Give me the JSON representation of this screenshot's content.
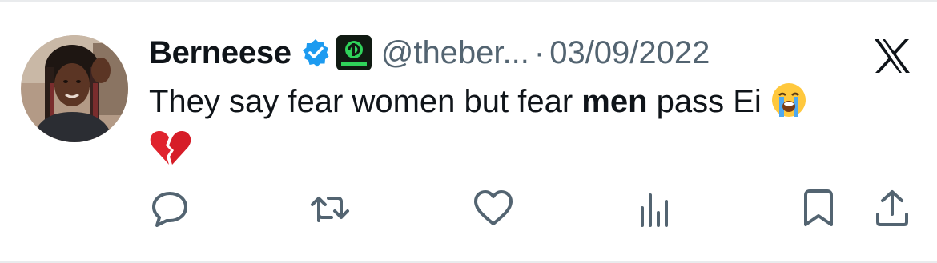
{
  "tweet": {
    "author_name": "Berneese",
    "handle": "@theber...",
    "separator": "·",
    "date": "03/09/2022",
    "text_before": "They say fear women but fear ",
    "text_bold": "men",
    "text_after": " pass Ei"
  },
  "icons": {
    "verified": "verified-badge-icon",
    "org_badge": "engine-badge-icon",
    "platform": "x-logo-icon",
    "emoji_1": "loudly-crying-face-emoji",
    "emoji_2": "broken-heart-emoji",
    "actions": [
      "reply-icon",
      "retweet-icon",
      "like-icon",
      "views-icon",
      "bookmark-icon",
      "share-icon"
    ]
  },
  "colors": {
    "text": "#0f1419",
    "secondary": "#536471",
    "verified_blue": "#1d9bf0",
    "border": "#e9ebed"
  }
}
